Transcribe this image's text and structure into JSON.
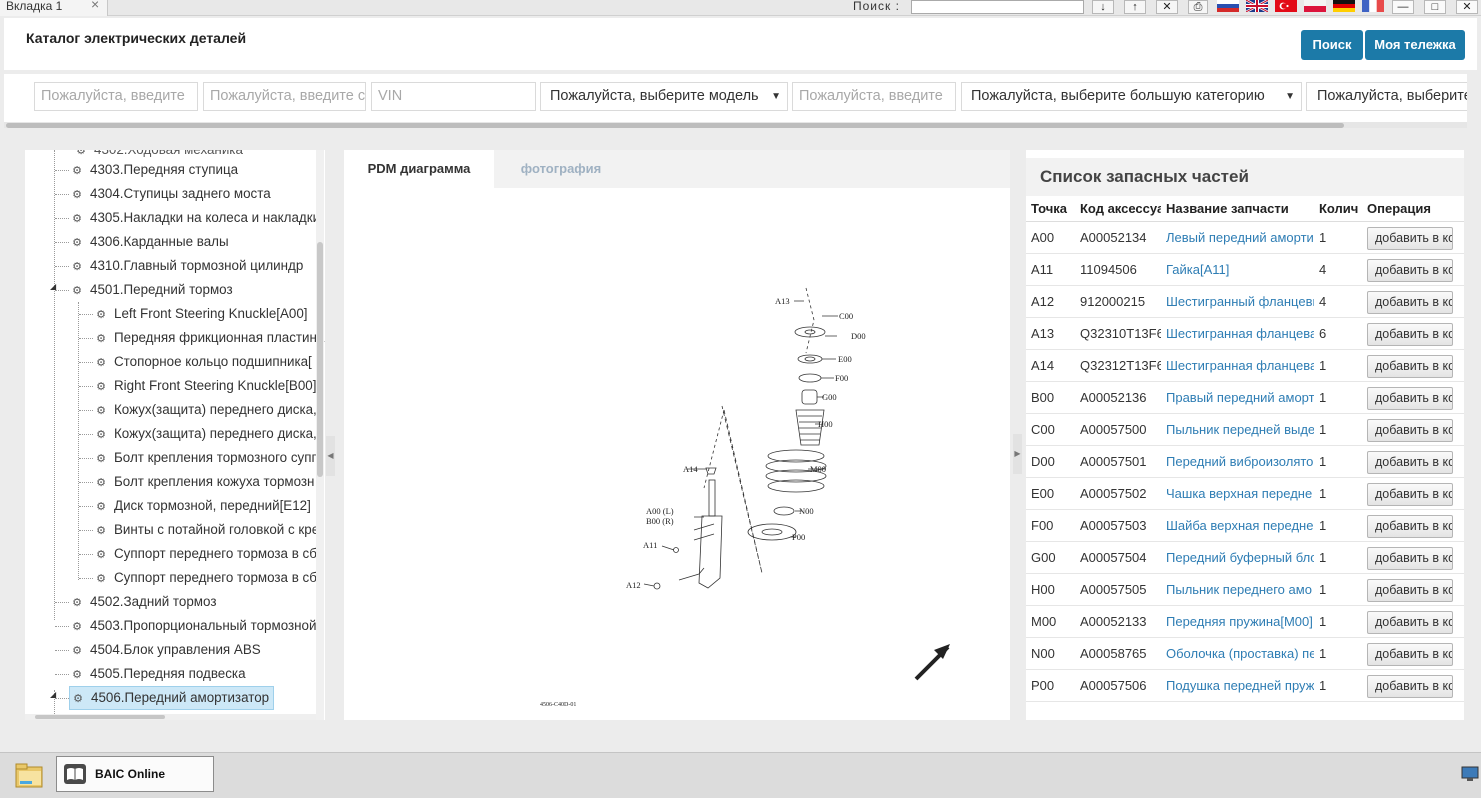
{
  "tabbar": {
    "tab_label": "Вкладка  1",
    "search_label": "Поиск  :",
    "search_value": ""
  },
  "toolbar_icons": [
    "download-icon",
    "upload-icon",
    "close-icon",
    "print-icon"
  ],
  "languages": [
    "ru",
    "en",
    "tr",
    "pl",
    "de",
    "fr"
  ],
  "window": {
    "minimize": "—",
    "maximize": "□",
    "close": "✕"
  },
  "header": {
    "title": "Каталог электрических деталей",
    "search_button": "Поиск",
    "cart_button": "Моя тележка"
  },
  "filters": [
    {
      "placeholder": "Пожалуйста, введите",
      "value": ""
    },
    {
      "placeholder": "Пожалуйста, введите с",
      "value": ""
    },
    {
      "placeholder": "VIN",
      "value": ""
    },
    {
      "placeholder": "",
      "value": "Пожалуйста, выберите модель"
    },
    {
      "placeholder": "Пожалуйста, введите",
      "value": ""
    },
    {
      "placeholder": "",
      "value": "Пожалуйста, выберите большую категорию"
    },
    {
      "placeholder": "",
      "value": "Пожалуйста, выберите"
    }
  ],
  "tree": {
    "items": [
      {
        "label": "4303.Передняя ступица",
        "level": 1
      },
      {
        "label": "4304.Ступицы заднего моста",
        "level": 1
      },
      {
        "label": "4305.Накладки на колеса и накладки",
        "level": 1
      },
      {
        "label": "4306.Карданные валы",
        "level": 1
      },
      {
        "label": "4310.Главный тормозной цилиндр",
        "level": 1
      },
      {
        "label": "4501.Передний тормоз",
        "level": 1
      },
      {
        "label": "Left Front Steering Knuckle[A00]",
        "level": 2
      },
      {
        "label": "Передняя фрикционная пластина",
        "level": 2
      },
      {
        "label": "Стопорное кольцо подшипника[",
        "level": 2
      },
      {
        "label": "Right Front Steering Knuckle[B00]",
        "level": 2
      },
      {
        "label": "Кожух(защита) переднего диска,",
        "level": 2
      },
      {
        "label": "Кожух(защита) переднего диска,",
        "level": 2
      },
      {
        "label": "Болт крепления тормозного супп",
        "level": 2
      },
      {
        "label": "Болт крепления кожуха тормозн",
        "level": 2
      },
      {
        "label": "Диск тормозной, передний[E12]",
        "level": 2
      },
      {
        "label": "Винты с потайной головкой с кре",
        "level": 2
      },
      {
        "label": "Суппорт переднего тормоза в сб",
        "level": 2
      },
      {
        "label": "Суппорт переднего тормоза в сб",
        "level": 2
      },
      {
        "label": "4502.Задний тормоз",
        "level": 1
      },
      {
        "label": "4503.Пропорциональный тормозной",
        "level": 1
      },
      {
        "label": "4504.Блок управления ABS",
        "level": 1
      },
      {
        "label": "4505.Передняя подвеска",
        "level": 1
      },
      {
        "label": "4506.Передний амортизатор",
        "level": 1,
        "selected": true
      }
    ]
  },
  "diagram_tabs": [
    {
      "label": "PDM диаграмма",
      "active": true
    },
    {
      "label": "фотография",
      "active": false
    }
  ],
  "diagram": {
    "code": "4506-C40D-01",
    "callouts": [
      "A13",
      "C00",
      "D00",
      "E00",
      "F00",
      "G00",
      "H00",
      "M00",
      "N00",
      "P00",
      "A14",
      "A00 (L)",
      "B00 (R)",
      "A11",
      "A12"
    ]
  },
  "parts": {
    "title": "Список запасных частей",
    "columns": [
      "Точка",
      "Код аксессуа",
      "Название запчасти",
      "Колич",
      "Операция"
    ],
    "add_label": "добавить в корзину",
    "rows": [
      {
        "point": "A00",
        "code": "A00052134",
        "name": "Левый передний аморти",
        "qty": "1"
      },
      {
        "point": "A11",
        "code": "11094506",
        "name": "Гайка[A11]",
        "qty": "4"
      },
      {
        "point": "A12",
        "code": "912000215",
        "name": "Шестигранный фланцевы",
        "qty": "4"
      },
      {
        "point": "A13",
        "code": "Q32310T13F6",
        "name": "Шестигранная фланцева",
        "qty": "6"
      },
      {
        "point": "A14",
        "code": "Q32312T13F6",
        "name": "Шестигранная фланцева",
        "qty": "1"
      },
      {
        "point": "B00",
        "code": "A00052136",
        "name": "Правый передний аморт",
        "qty": "1"
      },
      {
        "point": "C00",
        "code": "A00057500",
        "name": "Пыльник передней выде",
        "qty": "1"
      },
      {
        "point": "D00",
        "code": "A00057501",
        "name": "Передний виброизолято",
        "qty": "1"
      },
      {
        "point": "E00",
        "code": "A00057502",
        "name": "Чашка верхная  передне",
        "qty": "1"
      },
      {
        "point": "F00",
        "code": "A00057503",
        "name": "Шайба верхная  передне",
        "qty": "1"
      },
      {
        "point": "G00",
        "code": "A00057504",
        "name": "Передний буферный бло",
        "qty": "1"
      },
      {
        "point": "H00",
        "code": "A00057505",
        "name": "Пыльник переднего амо",
        "qty": "1"
      },
      {
        "point": "M00",
        "code": "A00052133",
        "name": "Передняя пружина[M00]",
        "qty": "1"
      },
      {
        "point": "N00",
        "code": "A00058765",
        "name": "Оболочка (проставка) пе",
        "qty": "1"
      },
      {
        "point": "P00",
        "code": "A00057506",
        "name": "Подушка  передней пруж",
        "qty": "1"
      }
    ]
  },
  "taskbar": {
    "app_label": "BAIC Online"
  }
}
